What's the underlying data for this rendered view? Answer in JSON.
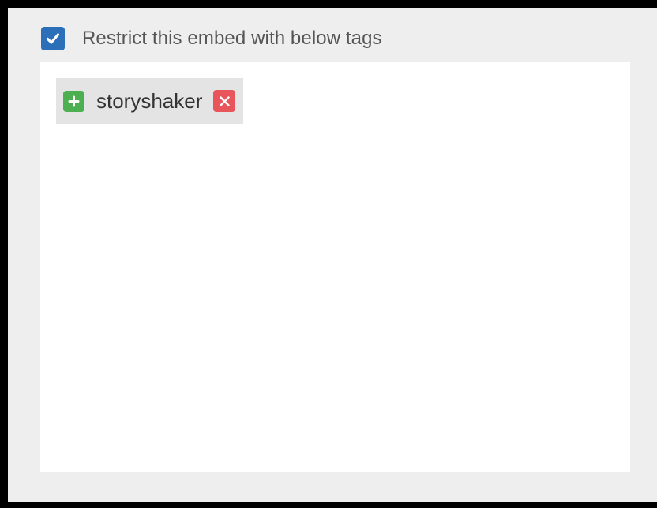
{
  "restrict": {
    "checked": true,
    "label": "Restrict this embed with below tags"
  },
  "tags": [
    {
      "label": "storyshaker",
      "add_icon": "plus-icon",
      "remove_icon": "close-icon"
    }
  ],
  "colors": {
    "checkbox": "#2a6fb8",
    "add": "#4caf50",
    "remove": "#e8555a",
    "panel": "#eeeeee",
    "tag_area": "#ffffff",
    "chip": "#e4e4e4"
  }
}
